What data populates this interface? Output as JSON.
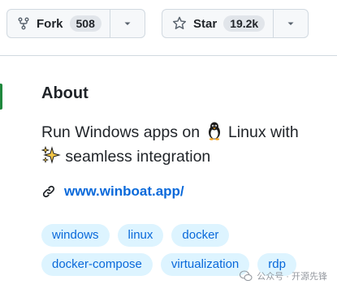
{
  "repo_actions": {
    "fork": {
      "label": "Fork",
      "count": "508",
      "icon": "repo-forked-icon"
    },
    "star": {
      "label": "Star",
      "count": "19.2k",
      "icon": "star-icon"
    }
  },
  "about": {
    "title": "About",
    "description_part1": "Run Windows apps on",
    "description_part2": "Linux with",
    "description_part3": "seamless integration",
    "emoji1": "penguin-emoji",
    "emoji2": "sparkles-emoji",
    "website": "www.winboat.app/",
    "topics": [
      "windows",
      "linux",
      "docker",
      "docker-compose",
      "virtualization",
      "rdp"
    ]
  },
  "watermark": {
    "text": "公众号 · 开源先锋"
  },
  "colors": {
    "accent_green": "#1f883d",
    "link_blue": "#0969da",
    "topic_bg": "#ddf4ff",
    "border": "#d1d9e0",
    "button_bg": "#f6f8fa"
  }
}
